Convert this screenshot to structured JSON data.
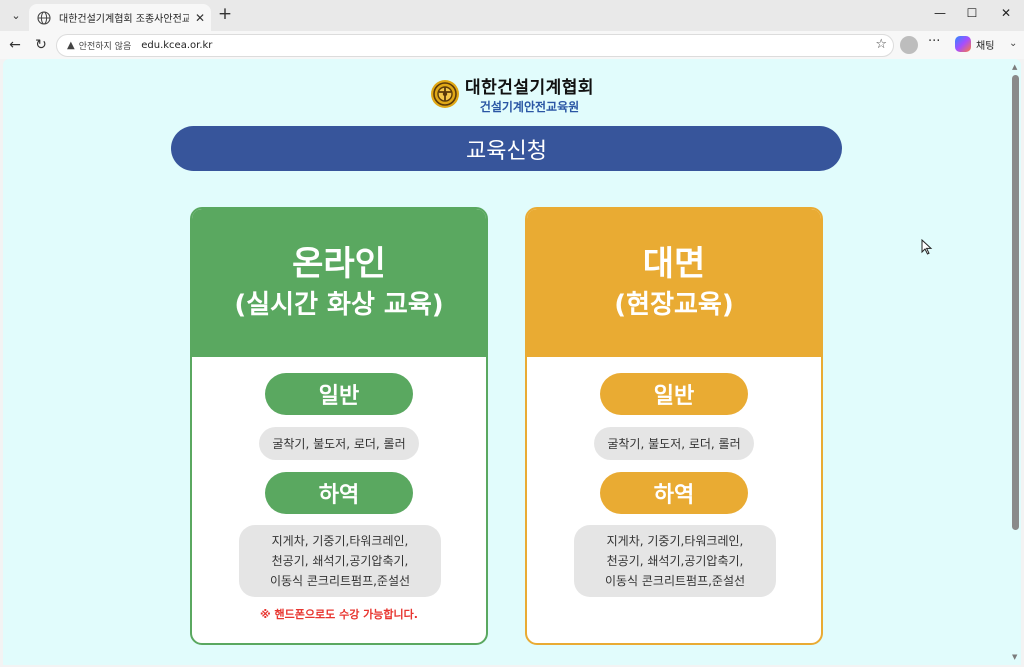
{
  "browser": {
    "tab_title": "대한건설기계협회 조종사안전교육",
    "tab_close": "✕",
    "new_tab": "+",
    "tab_list": "⌄",
    "security_label": "안전하지 않음",
    "url": "edu.kcea.or.kr",
    "copilot_label": "채팅",
    "more_label": "···",
    "window_minimize": "—",
    "window_maximize": "☐",
    "window_close": "✕"
  },
  "page": {
    "org_name": "대한건설기계협회",
    "org_sub": "건설기계안전교육원",
    "banner_title": "교육신청",
    "cards": [
      {
        "title": "온라인",
        "subtitle": "(실시간 화상 교육)",
        "general_label": "일반",
        "general_desc": "굴착기, 불도저, 로더, 롤러",
        "hayeok_label": "하역",
        "hayeok_desc_lines": [
          "지게차, 기중기,타워크레인,",
          "천공기, 쇄석기,공기압축기,",
          "이동식 콘크리트펌프,준설선"
        ],
        "notice": "※ 핸드폰으로도 수강 가능합니다."
      },
      {
        "title": "대면",
        "subtitle": "(현장교육)",
        "general_label": "일반",
        "general_desc": "굴착기, 불도저, 로더, 롤러",
        "hayeok_label": "하역",
        "hayeok_desc_lines": [
          "지게차, 기중기,타워크레인,",
          "천공기, 쇄석기,공기압축기,",
          "이동식 콘크리트펌프,준설선"
        ]
      }
    ]
  },
  "colors": {
    "online": "#5aa860",
    "offline": "#e9ab33",
    "banner": "#37559b",
    "background": "#e1fcfc",
    "notice": "#e8352f"
  }
}
